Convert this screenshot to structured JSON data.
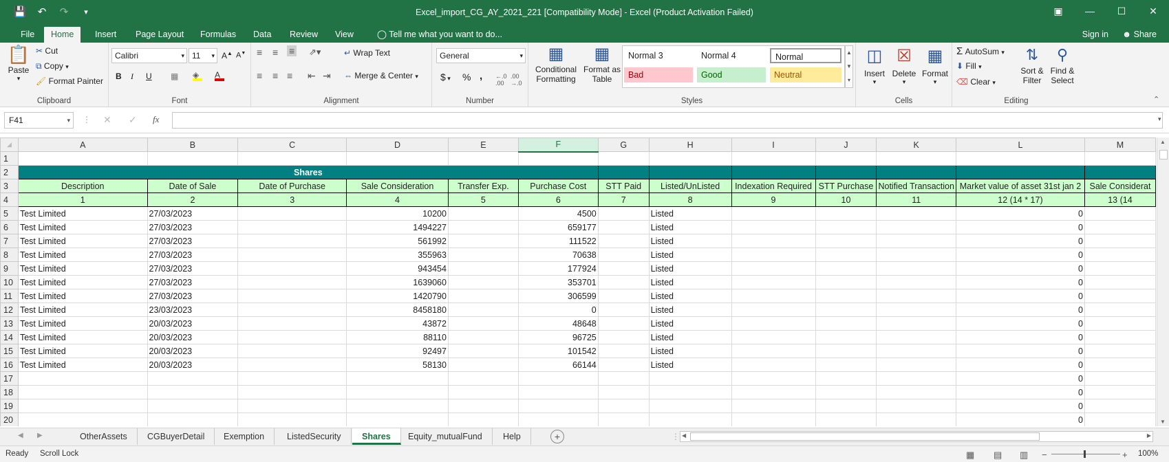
{
  "window": {
    "title": "Excel_import_CG_AY_2021_221  [Compatibility Mode] - Excel (Product Activation Failed)"
  },
  "ribbon_tabs": [
    "File",
    "Home",
    "Insert",
    "Page Layout",
    "Formulas",
    "Data",
    "Review",
    "View"
  ],
  "active_tab": "Home",
  "tell_me": "Tell me what you want to do...",
  "sign_in": "Sign in",
  "share": "Share",
  "clipboard": {
    "paste": "Paste",
    "cut": "Cut",
    "copy": "Copy",
    "format_painter": "Format Painter",
    "label": "Clipboard"
  },
  "font": {
    "name": "Calibri",
    "size": "11",
    "bold": "B",
    "italic": "I",
    "underline": "U",
    "label": "Font"
  },
  "alignment": {
    "wrap_text": "Wrap Text",
    "merge_center": "Merge & Center",
    "label": "Alignment"
  },
  "number": {
    "format": "General",
    "currency": "$",
    "percent": "%",
    "comma": ",",
    "label": "Number"
  },
  "styles": {
    "conditional": "Conditional Formatting",
    "format_as_table": "Format as Table",
    "normal3": "Normal 3",
    "normal4": "Normal 4",
    "normal": "Normal",
    "bad": "Bad",
    "good": "Good",
    "neutral": "Neutral",
    "label": "Styles"
  },
  "cells": {
    "insert": "Insert",
    "delete": "Delete",
    "format": "Format",
    "label": "Cells"
  },
  "editing": {
    "autosum": "AutoSum",
    "fill": "Fill",
    "clear": "Clear",
    "sort_filter": "Sort & Filter",
    "find_select": "Find & Select",
    "label": "Editing"
  },
  "formula_bar": {
    "name_box": "F41",
    "fx": "fx",
    "value": ""
  },
  "grid": {
    "columns": [
      "A",
      "B",
      "C",
      "D",
      "E",
      "F",
      "G",
      "H",
      "I",
      "J",
      "K",
      "L",
      "M"
    ],
    "selected_column": "F",
    "title": "Shares",
    "headers": [
      "Description",
      "Date of Sale",
      "Date of Purchase",
      "Sale Consideration",
      "Transfer Exp.",
      "Purchase Cost",
      "STT Paid",
      "Listed/UnListed",
      "Indexation Required",
      "STT Purchase",
      "Notified Transaction",
      "Market value of asset 31st jan 2",
      "Sale Considerat"
    ],
    "numbers": [
      "1",
      "2",
      "3",
      "4",
      "5",
      "6",
      "7",
      "8",
      "9",
      "10",
      "11",
      "12 (14 * 17)",
      "13 (14"
    ],
    "rows": [
      [
        "Test Limited",
        "27/03/2023",
        "",
        "10200",
        "",
        "4500",
        "",
        "Listed",
        "",
        "",
        "",
        "0",
        ""
      ],
      [
        "Test Limited",
        "27/03/2023",
        "",
        "1494227",
        "",
        "659177",
        "",
        "Listed",
        "",
        "",
        "",
        "0",
        ""
      ],
      [
        "Test Limited",
        "27/03/2023",
        "",
        "561992",
        "",
        "111522",
        "",
        "Listed",
        "",
        "",
        "",
        "0",
        ""
      ],
      [
        "Test Limited",
        "27/03/2023",
        "",
        "355963",
        "",
        "70638",
        "",
        "Listed",
        "",
        "",
        "",
        "0",
        ""
      ],
      [
        "Test Limited",
        "27/03/2023",
        "",
        "943454",
        "",
        "177924",
        "",
        "Listed",
        "",
        "",
        "",
        "0",
        ""
      ],
      [
        "Test Limited",
        "27/03/2023",
        "",
        "1639060",
        "",
        "353701",
        "",
        "Listed",
        "",
        "",
        "",
        "0",
        ""
      ],
      [
        "Test Limited",
        "27/03/2023",
        "",
        "1420790",
        "",
        "306599",
        "",
        "Listed",
        "",
        "",
        "",
        "0",
        ""
      ],
      [
        "Test Limited",
        "23/03/2023",
        "",
        "8458180",
        "",
        "0",
        "",
        "Listed",
        "",
        "",
        "",
        "0",
        ""
      ],
      [
        "Test Limited",
        "20/03/2023",
        "",
        "43872",
        "",
        "48648",
        "",
        "Listed",
        "",
        "",
        "",
        "0",
        ""
      ],
      [
        "Test Limited",
        "20/03/2023",
        "",
        "88110",
        "",
        "96725",
        "",
        "Listed",
        "",
        "",
        "",
        "0",
        ""
      ],
      [
        "Test Limited",
        "20/03/2023",
        "",
        "92497",
        "",
        "101542",
        "",
        "Listed",
        "",
        "",
        "",
        "0",
        ""
      ],
      [
        "Test Limited",
        "20/03/2023",
        "",
        "58130",
        "",
        "66144",
        "",
        "Listed",
        "",
        "",
        "",
        "0",
        ""
      ],
      [
        "",
        "",
        "",
        "",
        "",
        "",
        "",
        "",
        "",
        "",
        "",
        "0",
        ""
      ],
      [
        "",
        "",
        "",
        "",
        "",
        "",
        "",
        "",
        "",
        "",
        "",
        "0",
        ""
      ],
      [
        "",
        "",
        "",
        "",
        "",
        "",
        "",
        "",
        "",
        "",
        "",
        "0",
        ""
      ],
      [
        "",
        "",
        "",
        "",
        "",
        "",
        "",
        "",
        "",
        "",
        "",
        "0",
        ""
      ]
    ]
  },
  "sheets": [
    "OtherAssets",
    "CGBuyerDetail",
    "Exemption",
    "ListedSecurity",
    "Shares",
    "Equity_mutualFund",
    "Help"
  ],
  "active_sheet": "Shares",
  "status": {
    "ready": "Ready",
    "scroll_lock": "Scroll Lock",
    "zoom": "100%"
  },
  "colors": {
    "excel_green": "#217346",
    "teal": "#008080",
    "header_green": "#ccffcc"
  }
}
